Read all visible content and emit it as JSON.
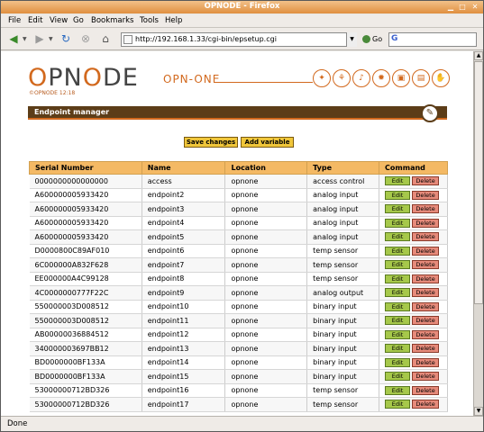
{
  "window": {
    "title": "OPNODE - Firefox"
  },
  "menu": [
    "File",
    "Edit",
    "View",
    "Go",
    "Bookmarks",
    "Tools",
    "Help"
  ],
  "nav": {
    "url": "http://192.168.1.33/cgi-bin/epsetup.cgi",
    "go_label": "Go",
    "search_placeholder": ""
  },
  "status": "Done",
  "page": {
    "logo_text": "OPNODE",
    "logo_sub": "OPN-ONE",
    "copyright": "©OPNODE  12:18",
    "section_title": "Endpoint manager",
    "save_label": "Save changes",
    "add_label": "Add variable"
  },
  "table": {
    "headers": [
      "Serial Number",
      "Name",
      "Location",
      "Type",
      "Command"
    ],
    "edit_label": "Edit",
    "delete_label": "Delete",
    "rows": [
      [
        "0000000000000000",
        "access",
        "opnone",
        "access control"
      ],
      [
        "A600000005933420",
        "endpoint2",
        "opnone",
        "analog input"
      ],
      [
        "A600000005933420",
        "endpoint3",
        "opnone",
        "analog input"
      ],
      [
        "A600000005933420",
        "endpoint4",
        "opnone",
        "analog input"
      ],
      [
        "A600000005933420",
        "endpoint5",
        "opnone",
        "analog input"
      ],
      [
        "D0000800C89AF010",
        "endpoint6",
        "opnone",
        "temp sensor"
      ],
      [
        "6C000000A832F628",
        "endpoint7",
        "opnone",
        "temp sensor"
      ],
      [
        "EE000000A4C99128",
        "endpoint8",
        "opnone",
        "temp sensor"
      ],
      [
        "4C0000000777F22C",
        "endpoint9",
        "opnone",
        "analog output"
      ],
      [
        "550000003D008512",
        "endpoint10",
        "opnone",
        "binary input"
      ],
      [
        "550000003D008512",
        "endpoint11",
        "opnone",
        "binary input"
      ],
      [
        "AB00000036884512",
        "endpoint12",
        "opnone",
        "binary input"
      ],
      [
        "340000003697BB12",
        "endpoint13",
        "opnone",
        "binary input"
      ],
      [
        "BD0000000BF133A",
        "endpoint14",
        "opnone",
        "binary input"
      ],
      [
        "BD0000000BF133A",
        "endpoint15",
        "opnone",
        "binary input"
      ],
      [
        "53000000712BD326",
        "endpoint16",
        "opnone",
        "temp sensor"
      ],
      [
        "53000000712BD326",
        "endpoint17",
        "opnone",
        "temp sensor"
      ]
    ]
  }
}
